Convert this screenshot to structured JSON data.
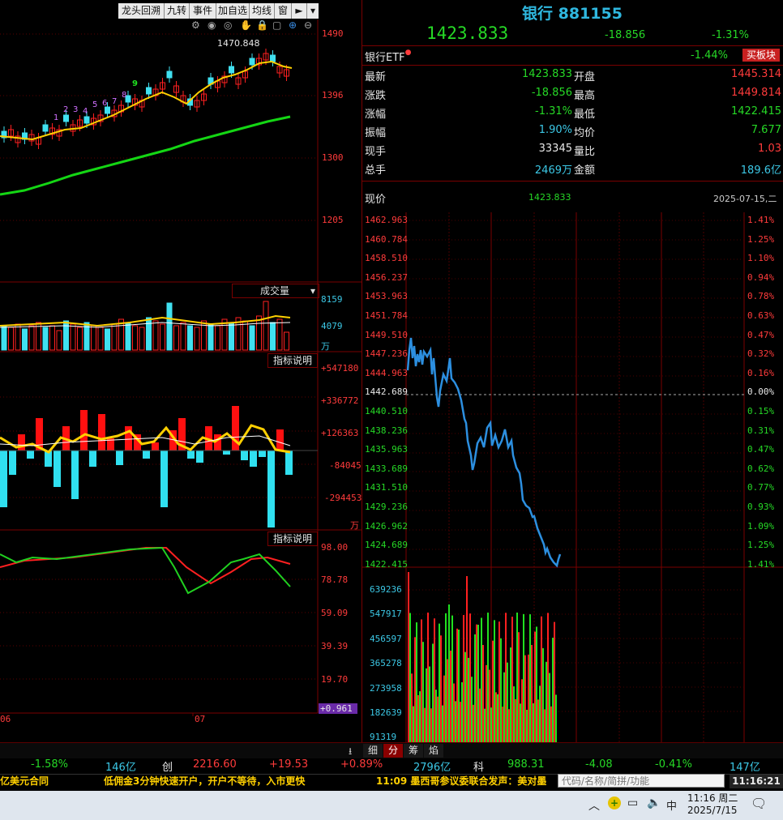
{
  "toolbar": {
    "buttons": [
      "龙头回溯",
      "九转",
      "事件",
      "加自选",
      "均线",
      "窗"
    ]
  },
  "kline": {
    "price_axis": [
      "1490",
      "1396",
      "1300",
      "1205"
    ],
    "max_label": "1470.848",
    "td_counts": [
      "1",
      "2",
      "3",
      "4",
      "5",
      "6",
      "7",
      "8",
      "9"
    ],
    "date_labels": [
      "06",
      "07"
    ]
  },
  "volume_panel": {
    "title": "成交量",
    "axis": [
      "8159",
      "4079",
      "万"
    ],
    "indicator_btn": "指标说明"
  },
  "fund_panel": {
    "axis": [
      "+547180",
      "+336772",
      "+126363",
      "-84045",
      "-294453",
      "万"
    ],
    "indicator_btn": "指标说明"
  },
  "kd_panel": {
    "axis": [
      "98.00",
      "78.78",
      "59.09",
      "39.39",
      "19.70",
      "+0.961"
    ]
  },
  "quote": {
    "name": "银行 881155",
    "price": "1423.833",
    "change": "-18.856",
    "change_pct": "-1.31%",
    "etf_label": "银行ETF",
    "etf_pct": "-1.44%",
    "etf_btn": "买板块",
    "rows": [
      {
        "l1": "最新",
        "v1": "1423.833",
        "l2": "开盘",
        "v2": "1445.314"
      },
      {
        "l1": "涨跌",
        "v1": "-18.856",
        "l2": "最高",
        "v2": "1449.814"
      },
      {
        "l1": "涨幅",
        "v1": "-1.31%",
        "l2": "最低",
        "v2": "1422.415"
      },
      {
        "l1": "振幅",
        "v1": "1.90%",
        "l2": "均价",
        "v2": "7.677"
      },
      {
        "l1": "现手",
        "v1": "33345",
        "l2": "量比",
        "v2": "1.03"
      },
      {
        "l1": "总手",
        "v1": "2469万",
        "l2": "金额",
        "v2": "189.6亿"
      }
    ]
  },
  "intraday": {
    "label": "现价",
    "current": "1423.833",
    "date": "2025-07-15,二",
    "left_axis": [
      "1462.963",
      "1460.784",
      "1458.510",
      "1456.237",
      "1453.963",
      "1451.784",
      "1449.510",
      "1447.236",
      "1444.963",
      "1442.689",
      "1440.510",
      "1438.236",
      "1435.963",
      "1433.689",
      "1431.510",
      "1429.236",
      "1426.962",
      "1424.689",
      "1422.415"
    ],
    "right_axis": [
      "1.41%",
      "1.25%",
      "1.10%",
      "0.94%",
      "0.78%",
      "0.63%",
      "0.47%",
      "0.32%",
      "0.16%",
      "0.00%",
      "0.15%",
      "0.31%",
      "0.47%",
      "0.62%",
      "0.77%",
      "0.93%",
      "1.09%",
      "1.25%",
      "1.41%"
    ],
    "vol_axis": [
      "639236",
      "547917",
      "456597",
      "365278",
      "273958",
      "182639",
      "91319"
    ]
  },
  "tabs": [
    "细",
    "分",
    "筹",
    "焰"
  ],
  "bottom_stats": {
    "a": "-1.58%",
    "b": "146亿",
    "c_label": "创",
    "c": "2216.60",
    "d": "+19.53",
    "e": "+0.89%",
    "f": "2796亿",
    "g_label": "科",
    "g": "988.31",
    "h": "-4.08",
    "i": "-0.41%",
    "j": "147亿"
  },
  "ticker": {
    "t1": "亿美元合同",
    "t2": "低佣金3分钟快速开户，开户不等待，入市更快",
    "t3": "11:09 墨西哥参议委联合发声：美对墨",
    "search_placeholder": "代码/名称/简拼/功能",
    "clock": "11:16:21"
  },
  "taskbar": {
    "ime": "中",
    "time": "11:16 周二",
    "date": "2025/7/15"
  }
}
